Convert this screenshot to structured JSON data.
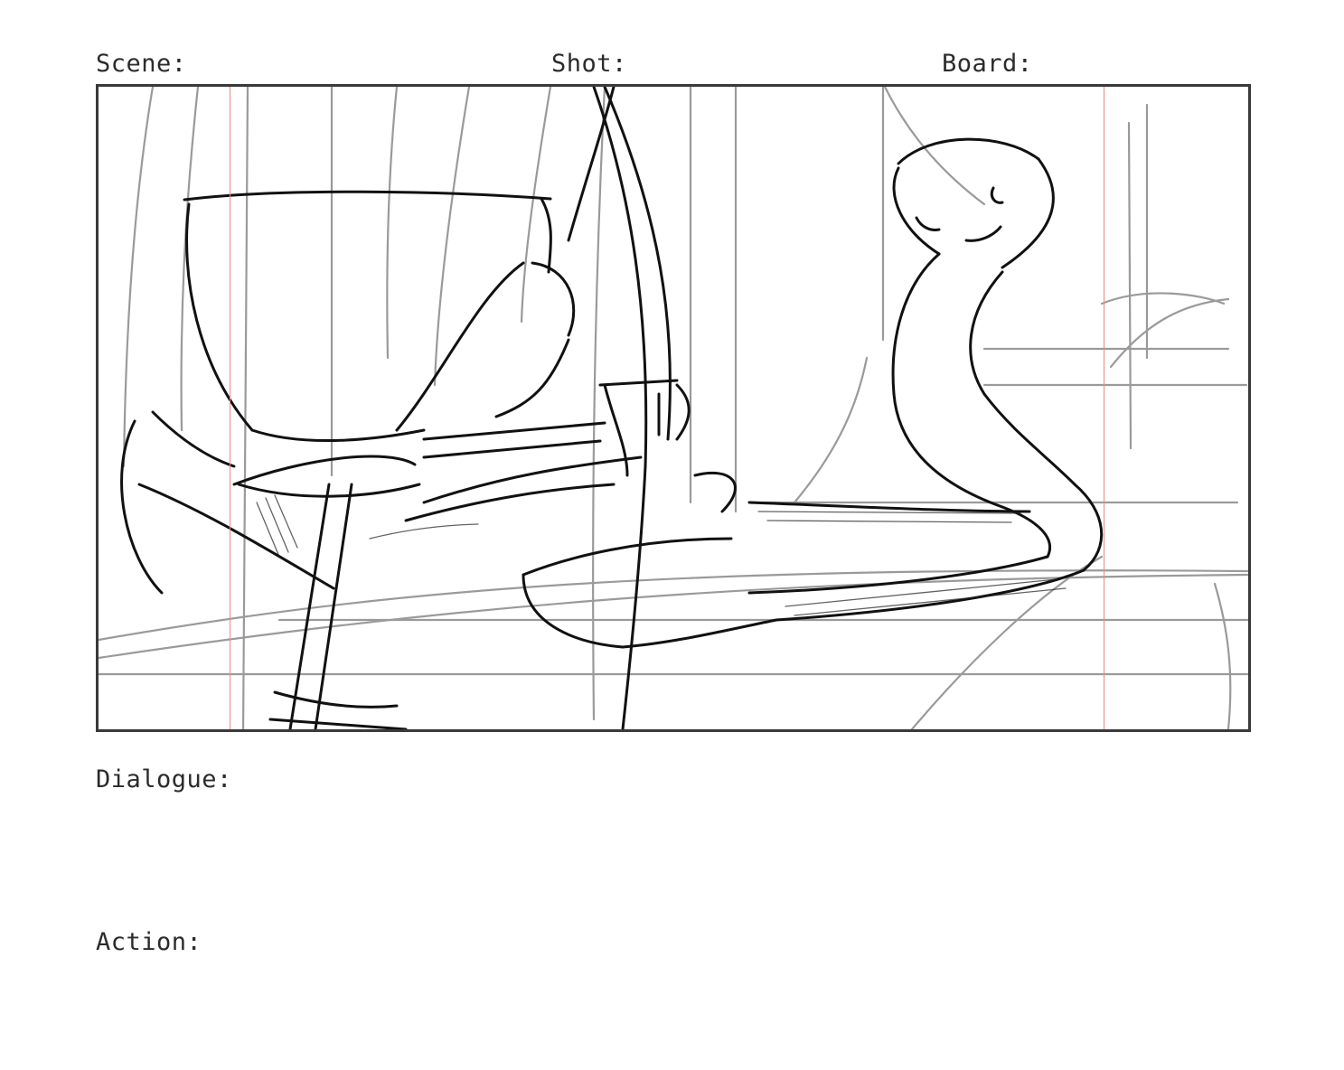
{
  "header": {
    "scene_label": "Scene:",
    "shot_label": "Shot:",
    "board_label": "Board:"
  },
  "notes": {
    "dialogue_label": "Dialogue:",
    "action_label": "Action:"
  },
  "colors": {
    "ink": "#111111",
    "construction": "#9a9a9a",
    "safe_guide": "#e98a8a",
    "frame_border": "#3a3a3a"
  }
}
